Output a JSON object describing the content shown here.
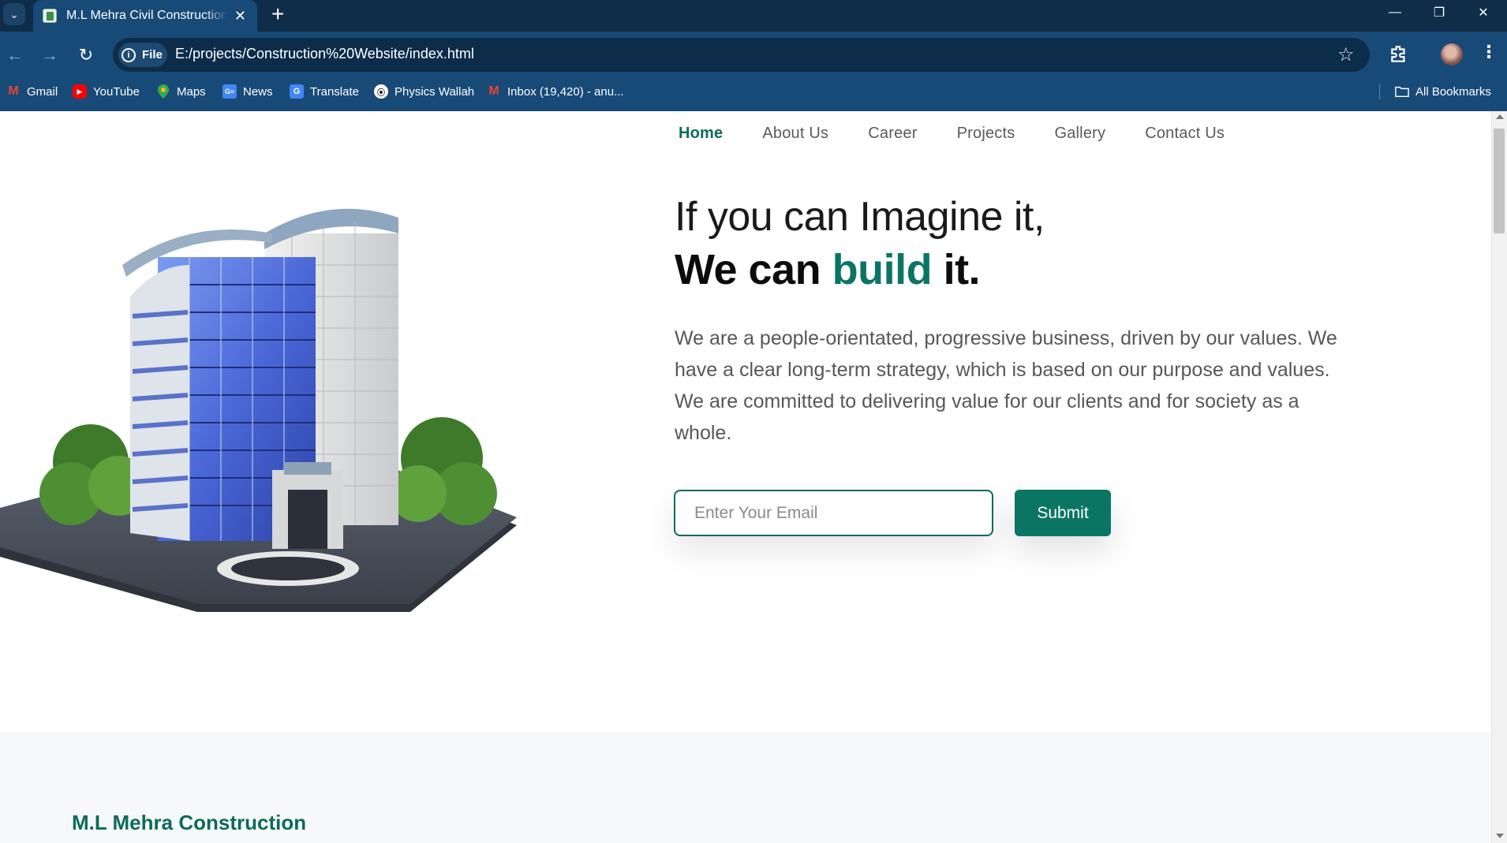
{
  "browser": {
    "tab_title": "M.L Mehra Civil Construction co",
    "site_chip": "File",
    "url": "E:/projects/Construction%20Website/index.html",
    "bookmarks": [
      {
        "label": "Gmail",
        "icon": "gmail-icon"
      },
      {
        "label": "YouTube",
        "icon": "youtube-icon"
      },
      {
        "label": "Maps",
        "icon": "maps-icon"
      },
      {
        "label": "News",
        "icon": "news-icon"
      },
      {
        "label": "Translate",
        "icon": "translate-icon"
      },
      {
        "label": "Physics Wallah",
        "icon": "physics-wallah-icon"
      },
      {
        "label": "Inbox (19,420) - anu...",
        "icon": "gmail-icon"
      }
    ],
    "all_bookmarks": "All Bookmarks"
  },
  "site": {
    "nav": [
      "Home",
      "About Us",
      "Career",
      "Projects",
      "Gallery",
      "Contact Us"
    ],
    "active_nav": "Home",
    "hero": {
      "line1": "If you can Imagine it,",
      "line2_prefix": "We can ",
      "line2_accent": "build",
      "line2_suffix": " it.",
      "paragraph": "We are a people-orientated, progressive business, driven by our values. We have a clear long-term strategy, which is based on our purpose and values. We are committed to delivering value for our clients and for society as a whole."
    },
    "form": {
      "email_placeholder": "Enter Your Email",
      "submit_label": "Submit"
    },
    "company_name": "M.L Mehra Construction"
  },
  "colors": {
    "accent": "#0b7564",
    "chrome_dark": "#0f2d48",
    "chrome": "#184a78"
  }
}
